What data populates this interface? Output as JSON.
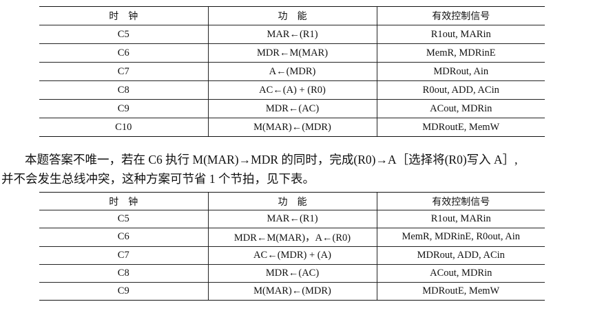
{
  "table1": {
    "headers": [
      "时　钟",
      "功　能",
      "有效控制信号"
    ],
    "rows": [
      [
        "C5",
        "MAR←(R1)",
        "R1out, MARin"
      ],
      [
        "C6",
        "MDR←M(MAR)",
        "MemR, MDRinE"
      ],
      [
        "C7",
        "A←(MDR)",
        "MDRout, Ain"
      ],
      [
        "C8",
        "AC←(A) + (R0)",
        "R0out, ADD, ACin"
      ],
      [
        "C9",
        "MDR←(AC)",
        "ACout, MDRin"
      ],
      [
        "C10",
        "M(MAR)←(MDR)",
        "MDRoutE, MemW"
      ]
    ]
  },
  "paragraph": {
    "line1": "本题答案不唯一，若在 C6 执行 M(MAR)→MDR 的同时，完成(R0)→A［选择将(R0)写入 A］,",
    "line2": "并不会发生总线冲突，这种方案可节省 1 个节拍，见下表。"
  },
  "table2": {
    "headers": [
      "时　钟",
      "功　能",
      "有效控制信号"
    ],
    "rows": [
      [
        "C5",
        "MAR←(R1)",
        "R1out, MARin"
      ],
      [
        "C6",
        "MDR←M(MAR)，A←(R0)",
        "MemR, MDRinE, R0out, Ain"
      ],
      [
        "C7",
        "AC←(MDR) + (A)",
        "MDRout, ADD, ACin"
      ],
      [
        "C8",
        "MDR←(AC)",
        "ACout, MDRin"
      ],
      [
        "C9",
        "M(MAR)←(MDR)",
        "MDRoutE, MemW"
      ]
    ]
  }
}
